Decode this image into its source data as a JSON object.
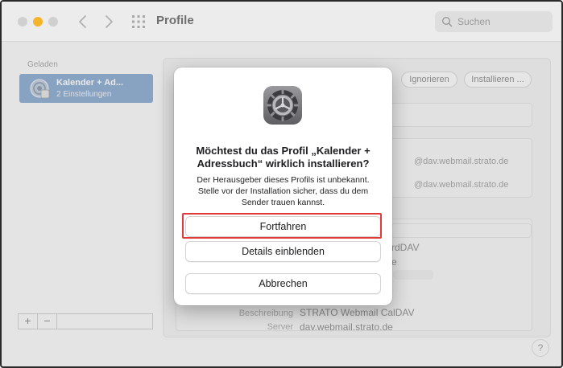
{
  "window": {
    "title": "Profile"
  },
  "search": {
    "placeholder": "Suchen",
    "icon": "search-icon"
  },
  "sidebar": {
    "heading": "Geladen",
    "items": [
      {
        "title": "Kalender + Ad...",
        "subtitle": "2 Einstellungen",
        "icon": "profile-icon"
      }
    ],
    "add_label": "+",
    "remove_label": "−"
  },
  "toolbar": {
    "ignore_label": "Ignorieren",
    "install_label": "Installieren ..."
  },
  "background": {
    "server_1": "@dav.webmail.strato.de",
    "server_2": "@dav.webmail.strato.de",
    "carddav_fragment": "rdDAV",
    "fragment_e": "e",
    "desc_label": "Beschreibung",
    "desc_value": "STRATO Webmail CalDAV",
    "server_label": "Server",
    "server_value": "dav.webmail.strato.de"
  },
  "help": {
    "label": "?"
  },
  "dialog": {
    "icon": "system-preferences-gear-icon",
    "title": "Möchtest du das Profil „Kalender + Adressbuch“ wirklich installieren?",
    "body": "Der Herausgeber dieses Profils ist unbekannt. Stelle vor der Installation sicher, dass du dem Sender trauen kannst.",
    "continue_label": "Fortfahren",
    "details_label": "Details einblenden",
    "cancel_label": "Abbrechen"
  },
  "colors": {
    "highlight": "#e03a3a",
    "selection": "#8da8c9",
    "minimize": "#f5b52b"
  }
}
